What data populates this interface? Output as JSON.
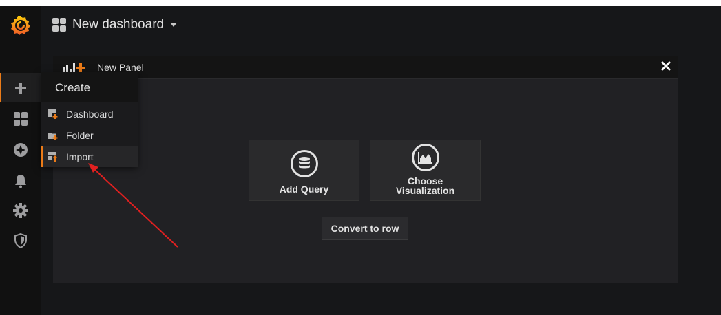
{
  "dashboard": {
    "title": "New dashboard"
  },
  "panel": {
    "title": "New Panel",
    "cards": [
      {
        "label": "Add Query",
        "icon": "database-icon"
      },
      {
        "label": "Choose Visualization",
        "icon": "area-chart-icon"
      }
    ],
    "convert_label": "Convert to row"
  },
  "sidebar": {
    "items": [
      {
        "name": "create",
        "icon": "plus-icon"
      },
      {
        "name": "dashboards",
        "icon": "apps-icon"
      },
      {
        "name": "explore",
        "icon": "compass-icon"
      },
      {
        "name": "alerting",
        "icon": "bell-icon"
      },
      {
        "name": "configuration",
        "icon": "gear-icon"
      },
      {
        "name": "server-admin",
        "icon": "shield-icon"
      }
    ]
  },
  "create_menu": {
    "header": "Create",
    "items": [
      {
        "label": "Dashboard",
        "icon": "dashboard-add-icon"
      },
      {
        "label": "Folder",
        "icon": "folder-add-icon"
      },
      {
        "label": "Import",
        "icon": "import-icon"
      }
    ]
  },
  "colors": {
    "accent": "#eb7b18",
    "annotation_arrow": "#e02020"
  }
}
